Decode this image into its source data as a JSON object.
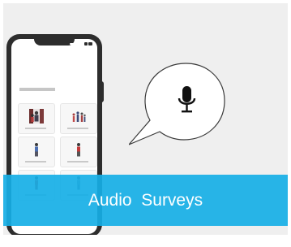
{
  "banner": {
    "label": "Audio  Surveys",
    "color": "#16afe6"
  },
  "icons": {
    "bubble": "microphone-icon",
    "phone_tiles": [
      "group-photo-icon",
      "people-icon",
      "person-icon",
      "person-icon",
      "person-icon",
      "person-icon"
    ]
  }
}
